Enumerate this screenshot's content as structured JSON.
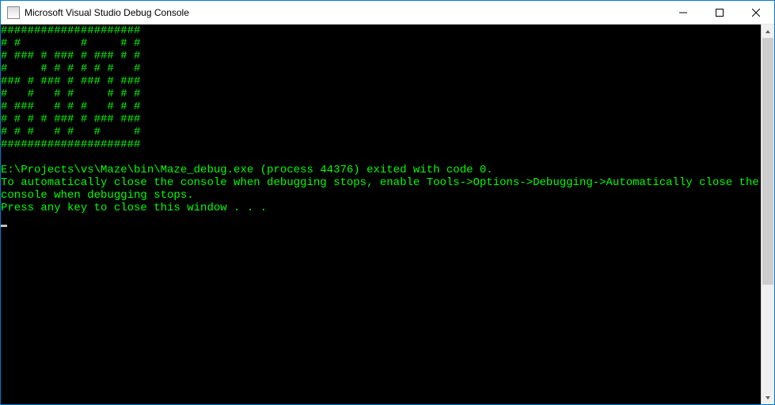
{
  "window": {
    "title": "Microsoft Visual Studio Debug Console"
  },
  "console": {
    "maze_lines": [
      "#####################",
      "# #         #     # #",
      "# ### # ### # ### # #",
      "#     # # # # # #   #",
      "### # ### # ### # ###",
      "#   #   # #     # # #",
      "# ###   # # #   # # #",
      "# # # # ### # ### ###",
      "# # #   # #   #     #",
      "#####################"
    ],
    "blank_line": "",
    "exit_line": "E:\\Projects\\vs\\Maze\\bin\\Maze_debug.exe (process 44376) exited with code 0.",
    "hint_line": "To automatically close the console when debugging stops, enable Tools->Options->Debugging->Automatically close the console when debugging stops.",
    "press_key_line": "Press any key to close this window . . .",
    "colors": {
      "background": "#000000",
      "foreground": "#00ff00"
    }
  }
}
